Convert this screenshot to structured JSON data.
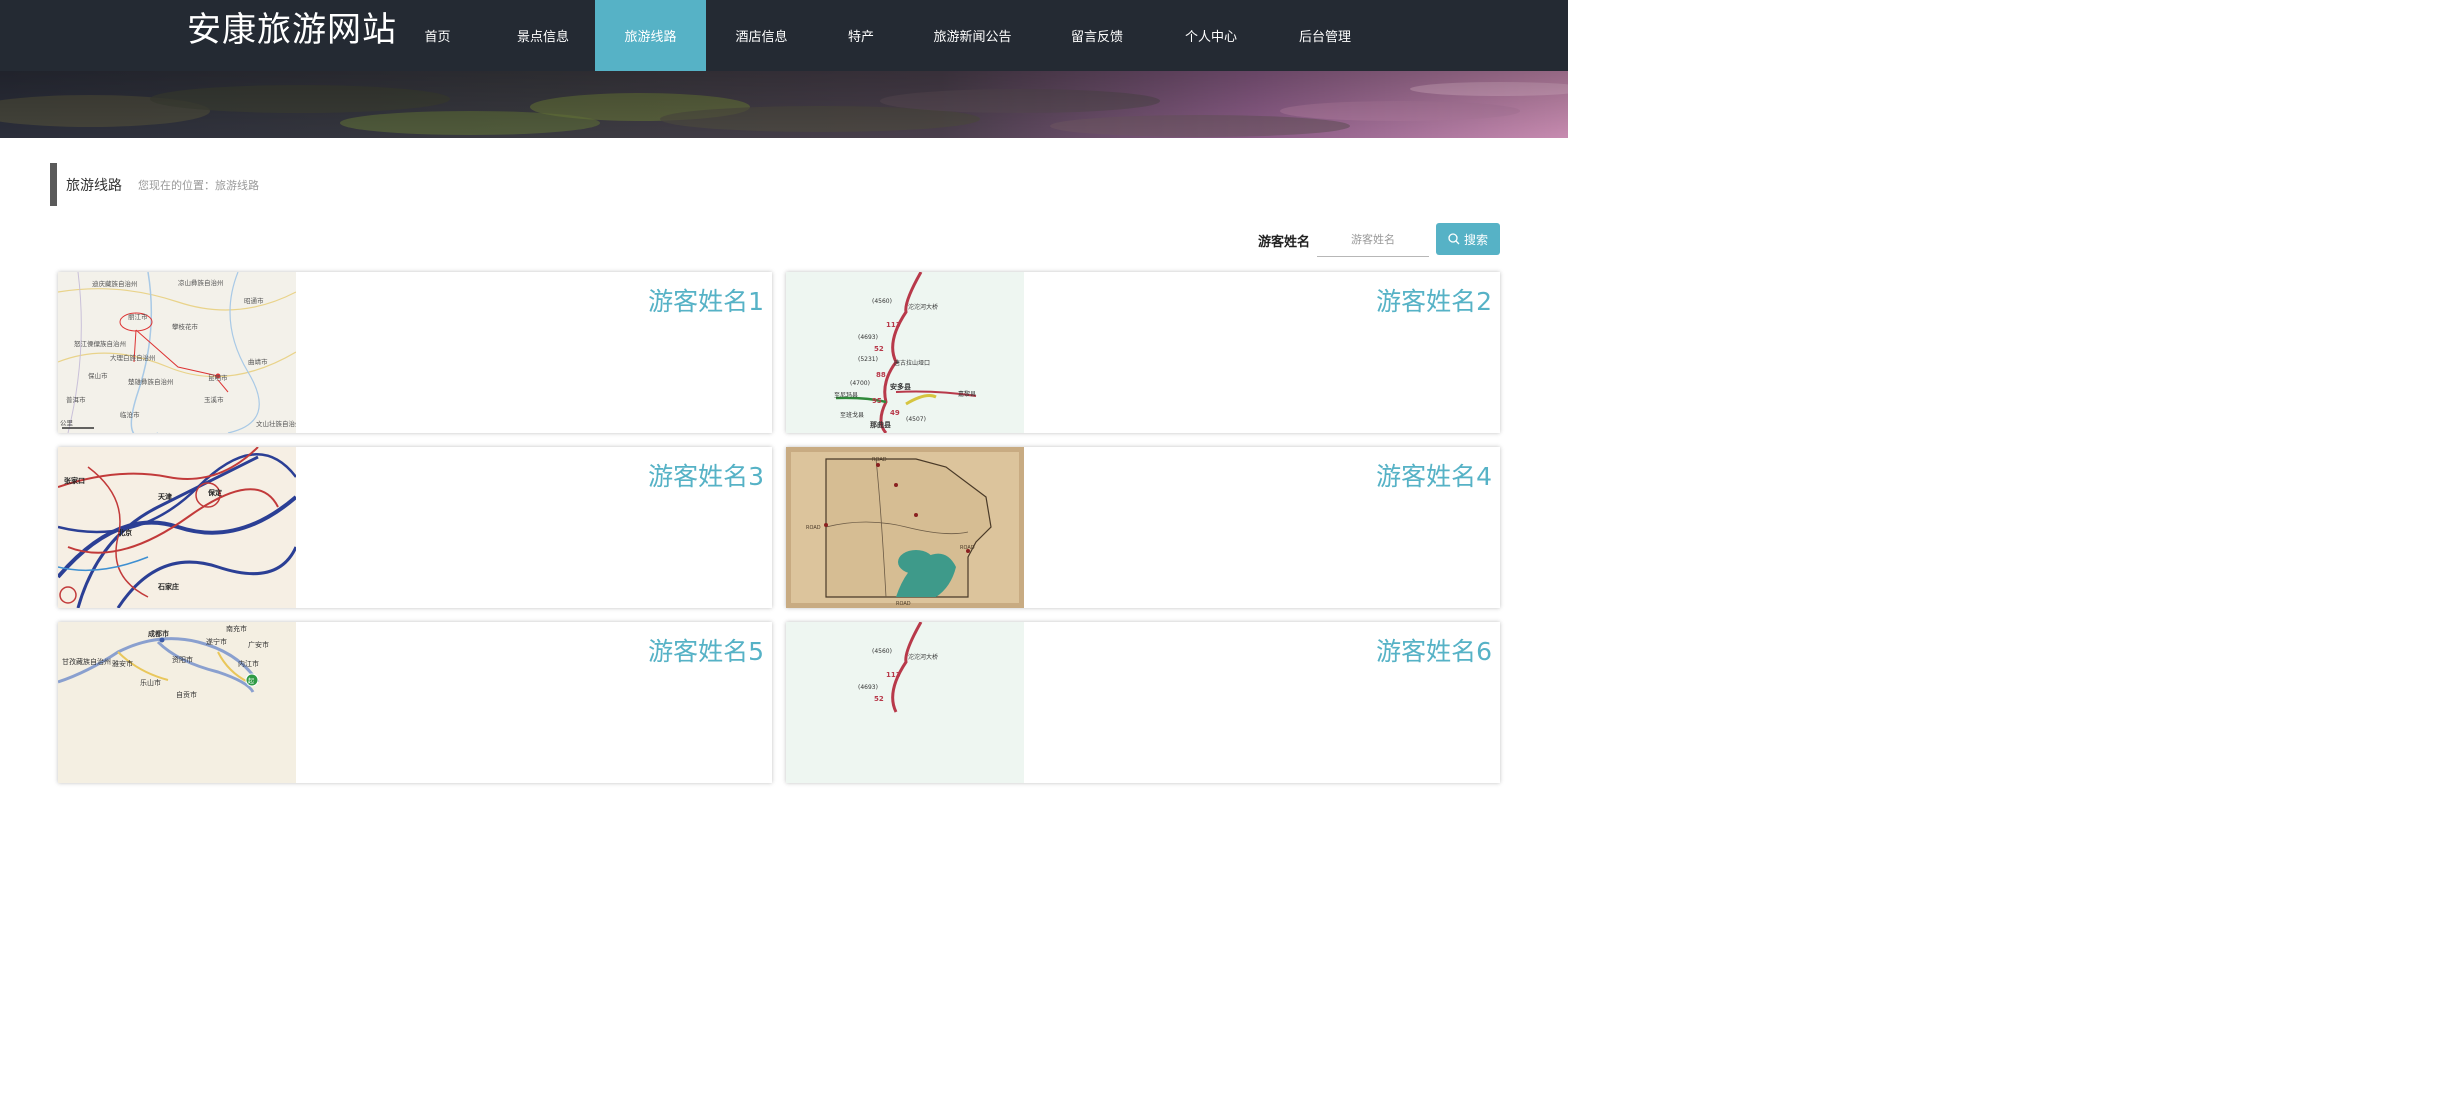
{
  "header": {
    "site_title": "安康旅游网站",
    "nav": [
      {
        "label": "首页",
        "active": false
      },
      {
        "label": "景点信息",
        "active": false
      },
      {
        "label": "旅游线路",
        "active": true
      },
      {
        "label": "酒店信息",
        "active": false
      },
      {
        "label": "特产",
        "active": false
      },
      {
        "label": "旅游新闻公告",
        "active": false
      },
      {
        "label": "留言反馈",
        "active": false
      },
      {
        "label": "个人中心",
        "active": false
      },
      {
        "label": "后台管理",
        "active": false
      }
    ]
  },
  "breadcrumb": {
    "title": "旅游线路",
    "location": "您现在的位置：旅游线路"
  },
  "search": {
    "label": "游客姓名",
    "placeholder": "游客姓名",
    "button_label": "搜索",
    "icon": "search-icon"
  },
  "cards": [
    {
      "name": "游客姓名1",
      "thumb": "map-route-yunnan"
    },
    {
      "name": "游客姓名2",
      "thumb": "map-road-tibet"
    },
    {
      "name": "游客姓名3",
      "thumb": "map-battle-routes"
    },
    {
      "name": "游客姓名4",
      "thumb": "map-vintage-park"
    },
    {
      "name": "游客姓名5",
      "thumb": "map-route-sichuan"
    },
    {
      "name": "游客姓名6",
      "thumb": "map-road-tibet"
    }
  ],
  "thumb_text": {
    "card1": {
      "labels": [
        "迪庆藏族自治州",
        "凉山彝族自治州",
        "丽江市",
        "攀枝花市",
        "昭通市",
        "怒江傈僳族自治州",
        "大理白族自治州",
        "曲靖市",
        "保山市",
        "昆明市",
        "楚雄彝族自治州",
        "玉溪市",
        "临沧市",
        "普洱市",
        "文山壮族自治州",
        "公里"
      ]
    },
    "card2": {
      "labels": [
        "(4560)",
        "沱沱河大桥",
        "(4693)",
        "(5231)",
        "唐古拉山垭口",
        "(4700)",
        "安多县",
        "至尼玛县",
        "嘉黎县",
        "至班戈县",
        "那曲县",
        "(4507)",
        "113",
        "52",
        "88",
        "95",
        "49"
      ]
    },
    "card3": {
      "labels": [
        "张家口",
        "北京",
        "天津",
        "保定",
        "石家庄"
      ]
    },
    "card4": {
      "labels": [
        "ROAD",
        "ROAD",
        "ROAD",
        "ROAD"
      ]
    },
    "card5": {
      "labels": [
        "成都市",
        "南充市",
        "遂宁市",
        "广安市",
        "甘孜藏族自治州",
        "雅安市",
        "资阳市",
        "乐山市",
        "自贡市",
        "内江市",
        "起"
      ]
    },
    "card6": {
      "labels": [
        "(4560)",
        "沱沱河大桥",
        "(4693)",
        "113",
        "52"
      ]
    }
  },
  "colors": {
    "topbar": "#242a33",
    "accent": "#56b2c6",
    "card_name": "#56b2c6"
  }
}
